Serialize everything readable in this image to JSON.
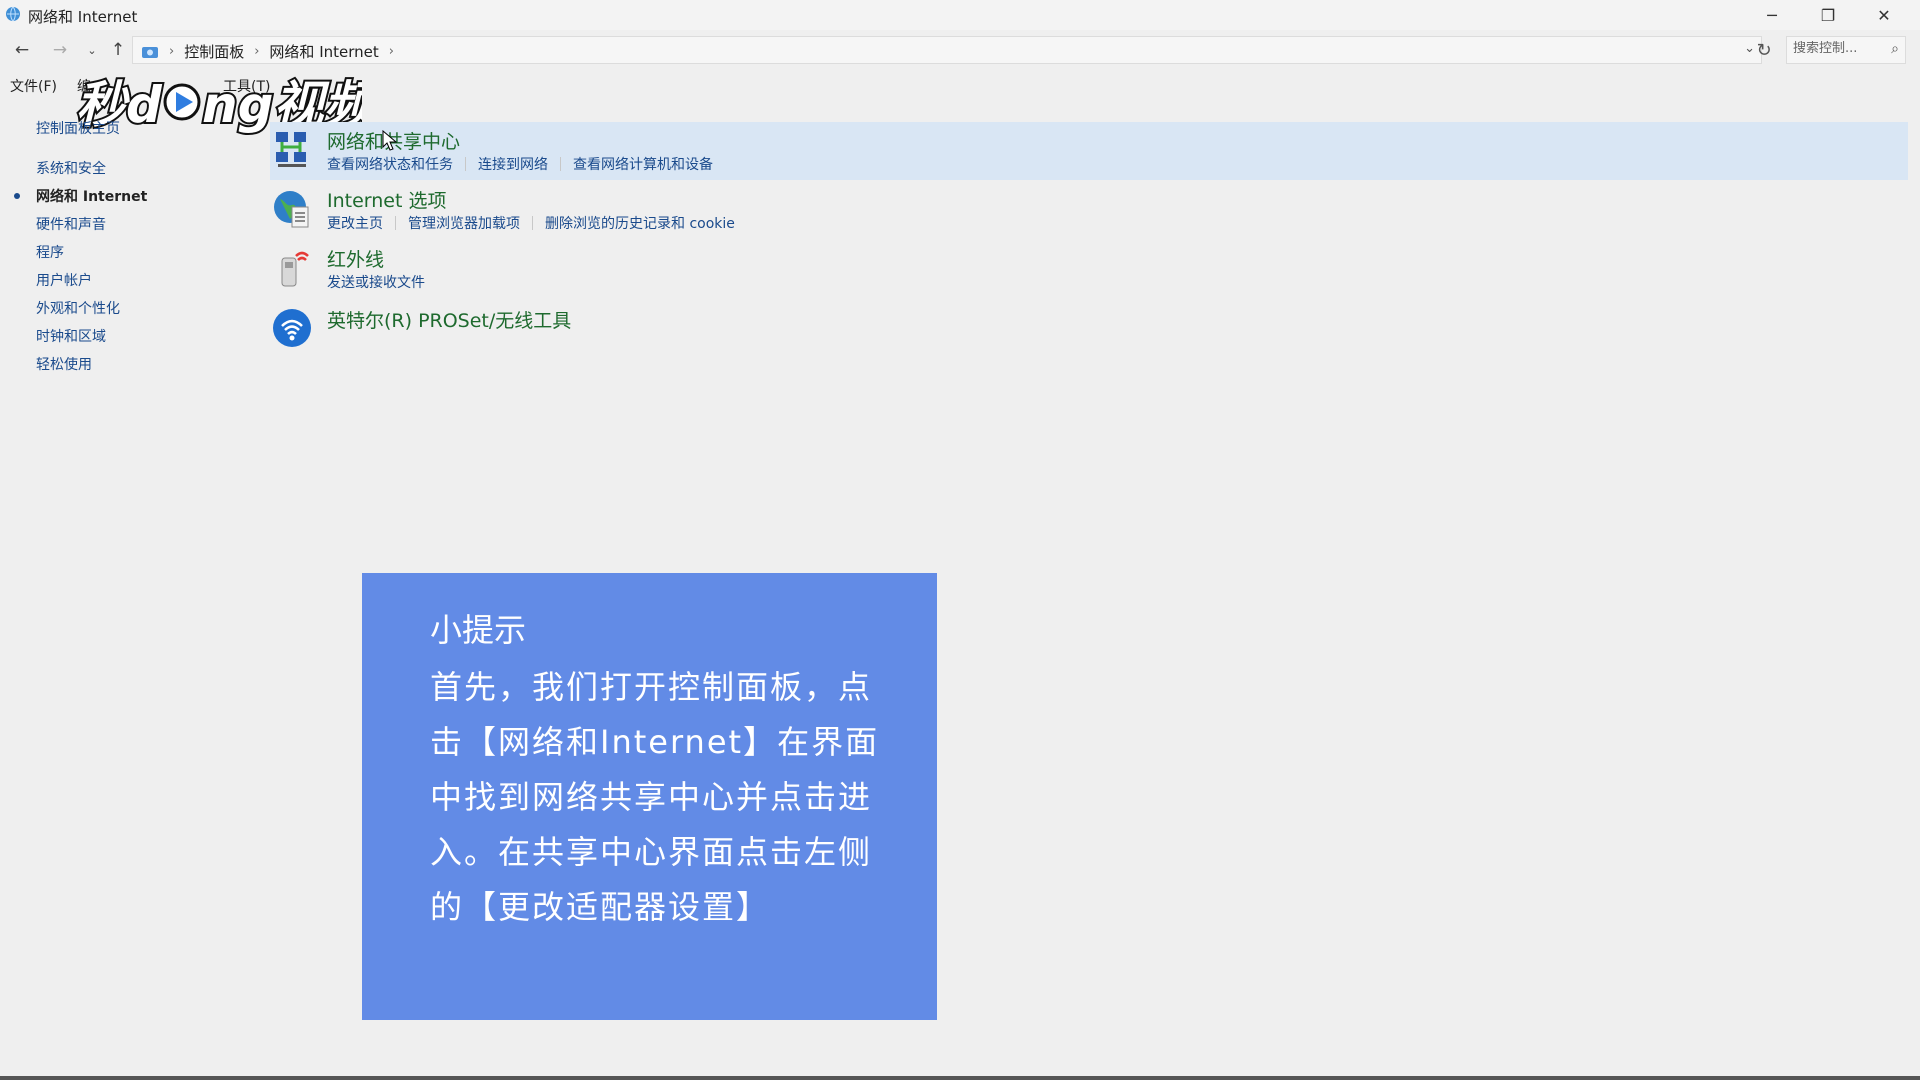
{
  "window": {
    "title": "网络和 Internet",
    "minimize_icon": "minimize-icon",
    "restore_icon": "restore-icon",
    "close_icon": "close-icon"
  },
  "address_bar": {
    "breadcrumb": [
      "控制面板",
      "网络和 Internet"
    ],
    "search_placeholder": "搜索控制..."
  },
  "menu": {
    "file": "文件(F)",
    "edit_partial": "编",
    "tools_partial": "工具(T)"
  },
  "watermark": {
    "brand": "秒懂视频"
  },
  "sidebar": {
    "home": "控制面板主页",
    "items": [
      {
        "label": "系统和安全",
        "active": false
      },
      {
        "label": "网络和 Internet",
        "active": true
      },
      {
        "label": "硬件和声音",
        "active": false
      },
      {
        "label": "程序",
        "active": false
      },
      {
        "label": "用户帐户",
        "active": false
      },
      {
        "label": "外观和个性化",
        "active": false
      },
      {
        "label": "时钟和区域",
        "active": false
      },
      {
        "label": "轻松使用",
        "active": false
      }
    ]
  },
  "categories": [
    {
      "title": "网络和共享中心",
      "links": [
        "查看网络状态和任务",
        "连接到网络",
        "查看网络计算机和设备"
      ],
      "icon": "network-sharing-icon"
    },
    {
      "title": "Internet 选项",
      "links": [
        "更改主页",
        "管理浏览器加载项",
        "删除浏览的历史记录和 cookie"
      ],
      "icon": "internet-options-icon"
    },
    {
      "title": "红外线",
      "links": [
        "发送或接收文件"
      ],
      "icon": "infrared-icon"
    },
    {
      "title": "英特尔(R) PROSet/无线工具",
      "links": [],
      "icon": "wireless-icon"
    }
  ],
  "tip": {
    "title": "小提示",
    "body": "首先，我们打开控制面板，点击【网络和Internet】在界面中找到网络共享中心并点击进入。在共享中心界面点击左侧的【更改适配器设置】"
  },
  "colors": {
    "tip_background": "#628be6",
    "link": "#1a4a8c",
    "category_title": "#1e6a2e",
    "hover_row": "#d9e6f4"
  }
}
